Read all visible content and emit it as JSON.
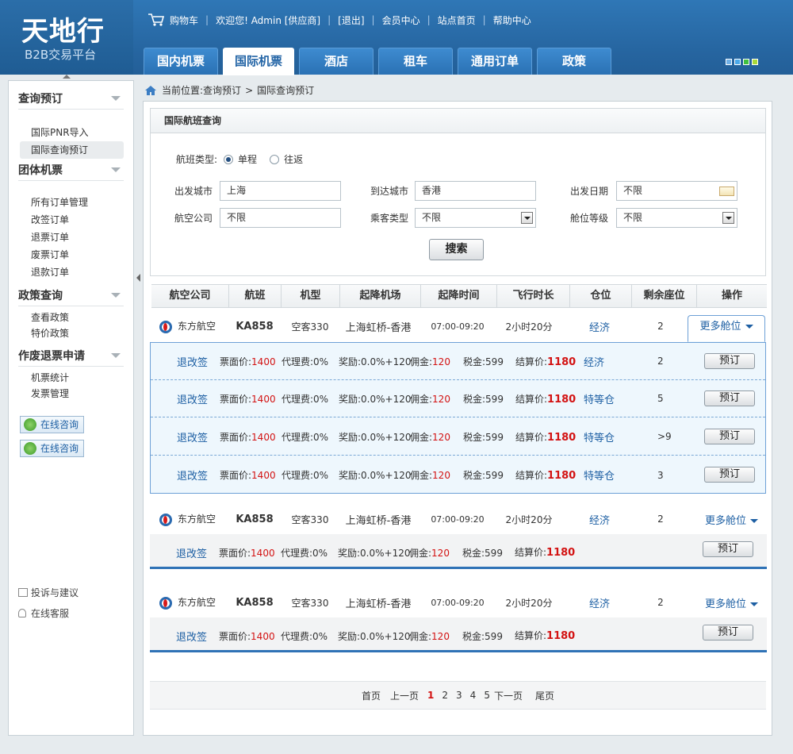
{
  "logo": {
    "title": "天地行",
    "subtitle": "B2B交易平台"
  },
  "topbar": {
    "cart": "购物车",
    "welcome": "欢迎您! Admin [供应商]",
    "logout": "[退出]",
    "member": "会员中心",
    "home": "站点首页",
    "help": "帮助中心"
  },
  "tabs": [
    "国内机票",
    "国际机票",
    "酒店",
    "租车",
    "通用订单",
    "政策"
  ],
  "skin_colors": [
    "#6fb0e6",
    "#4aa8e8",
    "#3fbf3f",
    "#a7d83a"
  ],
  "sidebar": {
    "sections": [
      {
        "title": "查询预订",
        "items": [
          "国际PNR导入",
          "国际查询预订"
        ]
      },
      {
        "title": "团体机票",
        "items": [
          "所有订单管理",
          "改签订单",
          "退票订单",
          "废票订单",
          "退款订单"
        ]
      },
      {
        "title": "政策查询",
        "items": [
          "查看政策",
          "特价政策"
        ]
      },
      {
        "title": "作废退票申请",
        "items": [
          "机票统计",
          "发票管理"
        ]
      }
    ],
    "consult": "在线咨询",
    "feedback": "投诉与建议",
    "service": "在线客服"
  },
  "crumb": {
    "prefix": "当前位置:",
    "level1": "查询预订",
    "sep": ">",
    "level2": "国际查询预订"
  },
  "search": {
    "title": "国际航班查询",
    "trip_label": "航班类型:",
    "oneway": "单程",
    "roundtrip": "往返",
    "from_label": "出发城市",
    "from": "上海",
    "to_label": "到达城市",
    "to": "香港",
    "date_label": "出发日期",
    "date": "不限",
    "airline_label": "航空公司",
    "airline": "不限",
    "pax_label": "乘客类型",
    "pax": "不限",
    "cabin_label": "舱位等级",
    "cabin": "不限",
    "button": "搜索"
  },
  "columns": [
    "航空公司",
    "航班",
    "机型",
    "起降机场",
    "起降时间",
    "飞行时长",
    "仓位",
    "剩余座位",
    "操作"
  ],
  "flight": {
    "airline": "东方航空",
    "no": "KA858",
    "plane": "空客330",
    "airports": "上海虹桥-香港",
    "time": "07:00-09:20",
    "duration": "2小时20分",
    "cabin": "经济",
    "seats": "2",
    "more": "更多舱位"
  },
  "sub": {
    "change": "退改签",
    "face_label": "票面价:",
    "face": "1400",
    "agent": "代理费:0%",
    "reward": "奖励:0.0%+120",
    "comm_label": "佣金:",
    "comm": "120",
    "tax": "税金:599",
    "settle_label": "结算价:",
    "settle": "1180",
    "book": "预订"
  },
  "subrows": [
    {
      "cabin": "经济",
      "seats": "2"
    },
    {
      "cabin": "特等仓",
      "seats": "5"
    },
    {
      "cabin": "特等仓",
      "seats": ">9"
    },
    {
      "cabin": "特等仓",
      "seats": "3"
    }
  ],
  "pager": {
    "first": "首页",
    "prev": "上一页",
    "pages": [
      "1",
      "2",
      "3",
      "4",
      "5"
    ],
    "next": "下一页",
    "last": "尾页"
  }
}
